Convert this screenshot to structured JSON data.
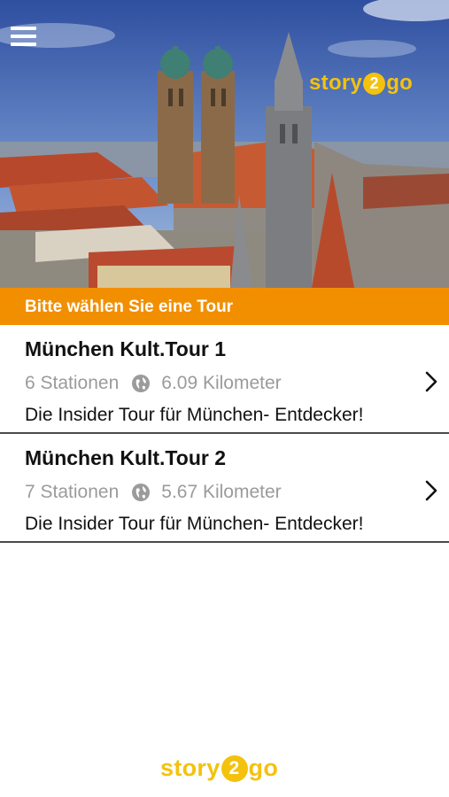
{
  "header": {
    "menu_icon": "hamburger-menu-icon",
    "logo": {
      "pre": "story",
      "num": "2",
      "post": "go"
    }
  },
  "banner": {
    "text": "Bitte wählen Sie eine Tour"
  },
  "tours": [
    {
      "title": "München Kult.Tour 1",
      "stations": "6 Stationen",
      "distance": "6.09 Kilometer",
      "description": "Die Insider Tour für München- Entdecker!"
    },
    {
      "title": "München Kult.Tour 2",
      "stations": "7 Stationen",
      "distance": "5.67 Kilometer",
      "description": "Die Insider Tour für München- Entdecker!"
    }
  ],
  "footer": {
    "logo": {
      "pre": "story",
      "num": "2",
      "post": "go"
    }
  },
  "colors": {
    "accent": "#f28f00",
    "logo": "#f4c20d",
    "meta_gray": "#9b9b9b"
  }
}
